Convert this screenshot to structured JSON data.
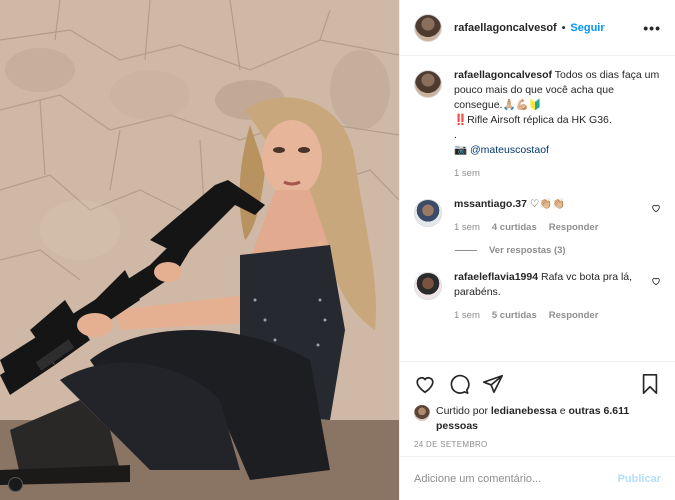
{
  "post": {
    "username": "rafaellagoncalvesof",
    "separator": "•",
    "follow_label": "Seguir",
    "more_label": "•••"
  },
  "caption": {
    "username": "rafaellagoncalvesof",
    "text_line1": "Todos os dias faça um pouco mais do que você acha que consegue.🙏🏼💪🏼🔰",
    "text_line2": "‼️Rifle Airsoft réplica da HK G36.",
    "text_line3": ".",
    "camera": "📷",
    "mention": "@mateuscostaof",
    "time": "1 sem"
  },
  "comments": [
    {
      "username": "mssantiago.37",
      "text": "♡👏🏼👏🏼",
      "time": "1 sem",
      "likes": "4 curtidas",
      "reply": "Responder",
      "view_replies": "Ver respostas (3)"
    },
    {
      "username": "rafaeleflavia1994",
      "text": "Rafa vc bota pra lá, parabéns.",
      "time": "1 sem",
      "likes": "5 curtidas",
      "reply": "Responder"
    }
  ],
  "likes": {
    "prefix": "Curtido por",
    "user": "ledianebessa",
    "conj": "e",
    "others": "outras 6.611 pessoas"
  },
  "date": "24 DE SETEMBRO",
  "add_comment": {
    "placeholder": "Adicione um comentário...",
    "publish_label": "Publicar"
  },
  "icons": [
    "heart-icon",
    "comment-icon",
    "share-icon",
    "bookmark-icon",
    "more-icon"
  ]
}
